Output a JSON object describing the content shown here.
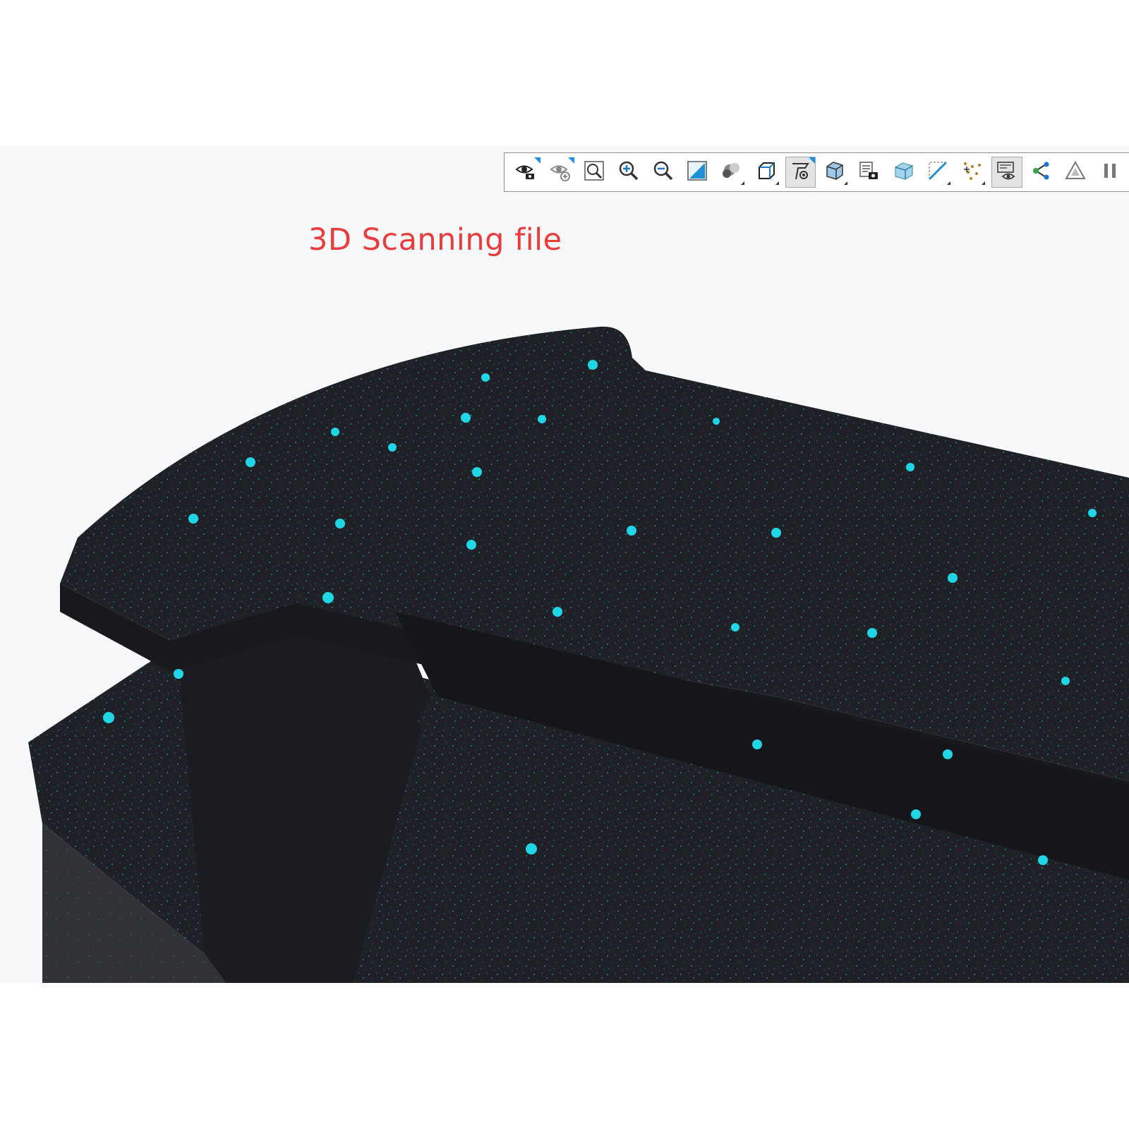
{
  "viewport": {
    "annotation": "3D Scanning file"
  },
  "toolbar": {
    "tools": [
      {
        "name": "eye-camera-icon",
        "flag": true
      },
      {
        "name": "eye-plus-icon",
        "flag": true
      },
      {
        "name": "zoom-fit-icon"
      },
      {
        "name": "zoom-in-icon"
      },
      {
        "name": "zoom-out-icon"
      },
      {
        "name": "zoom-window-icon"
      },
      {
        "name": "shading-icon",
        "sub": true
      },
      {
        "name": "cube-view-icon",
        "sub": true
      },
      {
        "name": "section-view-icon",
        "active": true,
        "flag": true
      },
      {
        "name": "display-cube-icon",
        "sub": true
      },
      {
        "name": "camera-list-icon"
      },
      {
        "name": "transparency-icon"
      },
      {
        "name": "plane-icon",
        "sub": true
      },
      {
        "name": "points-icon",
        "sub": true
      },
      {
        "name": "display-panel-icon",
        "active": true
      },
      {
        "name": "node-link-icon"
      },
      {
        "name": "triangle-warning-icon"
      },
      {
        "name": "pause-icon"
      }
    ]
  },
  "colors": {
    "mesh_body": "#202127",
    "mesh_speckle": "#1fc4d6",
    "annotation": "#ec3b3b",
    "toolbar_flag": "#1f8fe0"
  }
}
